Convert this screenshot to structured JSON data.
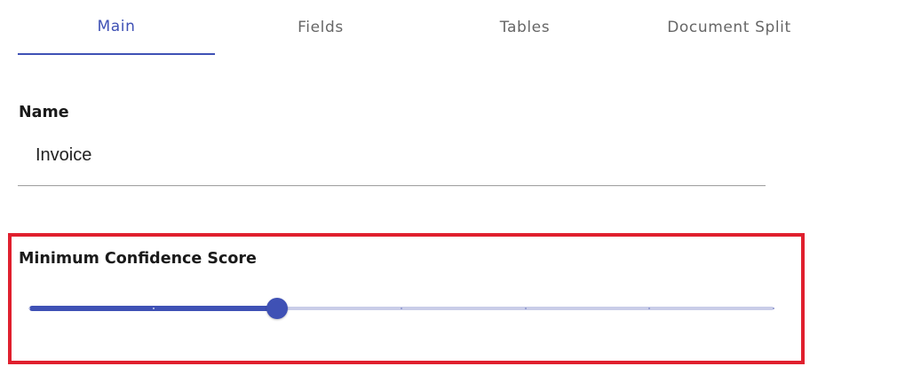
{
  "tabs": [
    {
      "label": "Main",
      "active": true
    },
    {
      "label": "Fields",
      "active": false
    },
    {
      "label": "Tables",
      "active": false
    },
    {
      "label": "Document Split",
      "active": false
    }
  ],
  "name_field": {
    "label": "Name",
    "value": "Invoice"
  },
  "confidence_field": {
    "label": "Minimum Confidence Score",
    "value_fraction": 0.333,
    "step_count": 6
  },
  "colors": {
    "accent": "#3f51b5",
    "highlight_border": "#e0202e"
  }
}
